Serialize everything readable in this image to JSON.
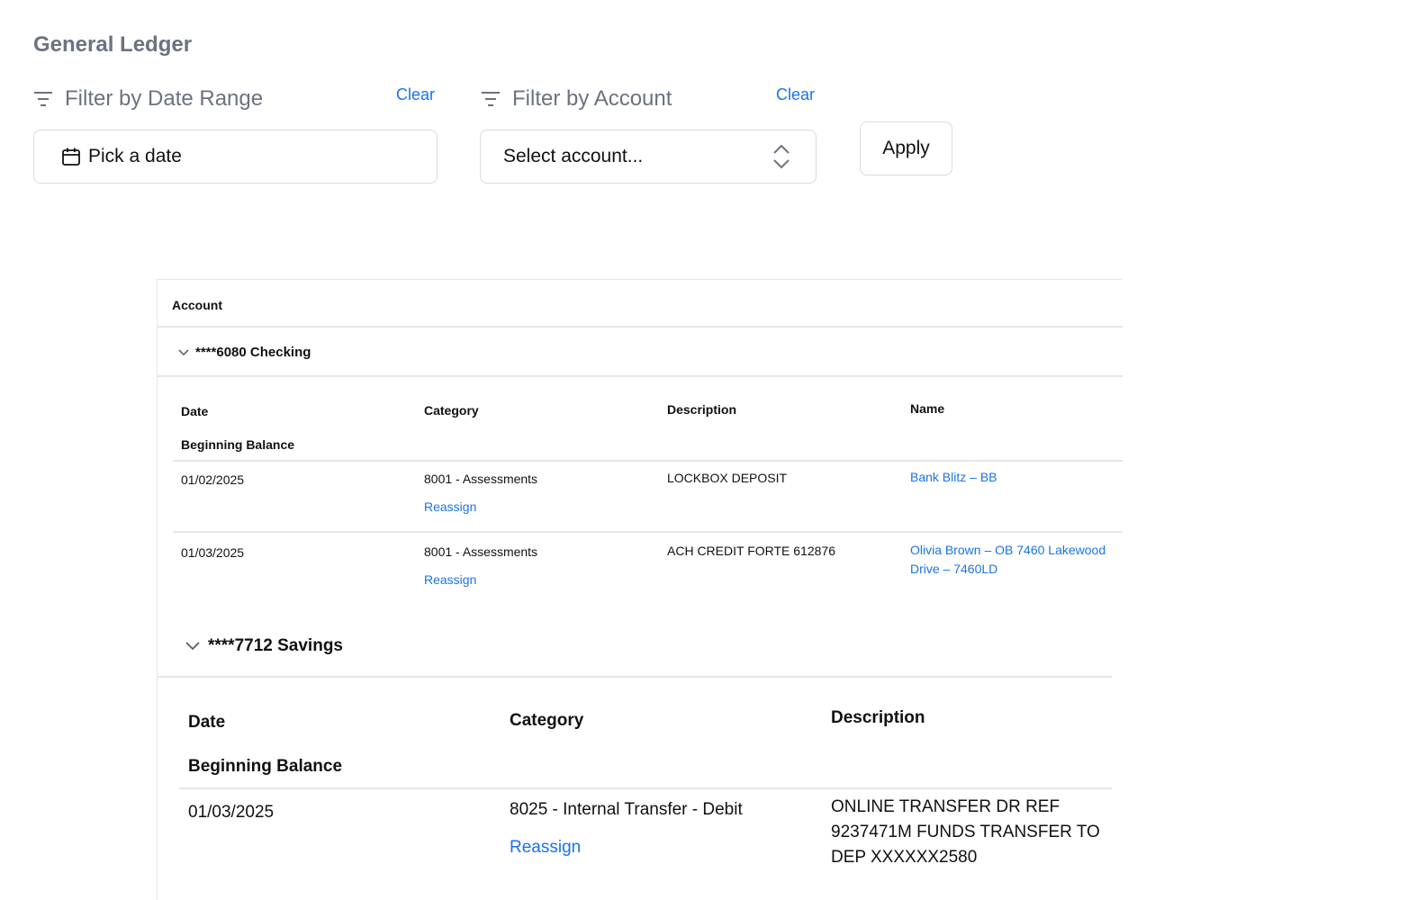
{
  "page": {
    "title": "General Ledger"
  },
  "filters": {
    "date_label": "Filter by Date Range",
    "date_clear": "Clear",
    "date_placeholder": "Pick a date",
    "account_label": "Filter by Account",
    "account_clear": "Clear",
    "account_placeholder": "Select account...",
    "apply": "Apply"
  },
  "ledger": {
    "header": "Account",
    "accounts": [
      {
        "name": "****6080 Checking",
        "columns": {
          "date": "Date",
          "category": "Category",
          "description": "Description",
          "name": "Name"
        },
        "beginning_balance": "Beginning Balance",
        "rows": [
          {
            "date": "01/02/2025",
            "category": "8001 - Assessments",
            "action": "Reassign",
            "description": "LOCKBOX DEPOSIT",
            "name_line1": "Bank Blitz – BB",
            "name_line2": ""
          },
          {
            "date": "01/03/2025",
            "category": "8001 - Assessments",
            "action": "Reassign",
            "description": "ACH CREDIT FORTE 612876",
            "name_line1": "Olivia Brown – OB 7460 Lakewood",
            "name_line2": "Drive – 7460LD"
          }
        ]
      },
      {
        "name": "****7712 Savings",
        "columns": {
          "date": "Date",
          "category": "Category",
          "description": "Description"
        },
        "beginning_balance": "Beginning Balance",
        "rows": [
          {
            "date": "01/03/2025",
            "category": "8025 - Internal Transfer - Debit",
            "action": "Reassign",
            "description_line1": "ONLINE TRANSFER DR REF",
            "description_line2": "9237471M FUNDS TRANSFER TO",
            "description_line3": "DEP XXXXXX2580"
          }
        ]
      }
    ]
  },
  "colors": {
    "link": "#1a73e8",
    "muted": "#6b7280",
    "border": "#d9dbe0"
  }
}
